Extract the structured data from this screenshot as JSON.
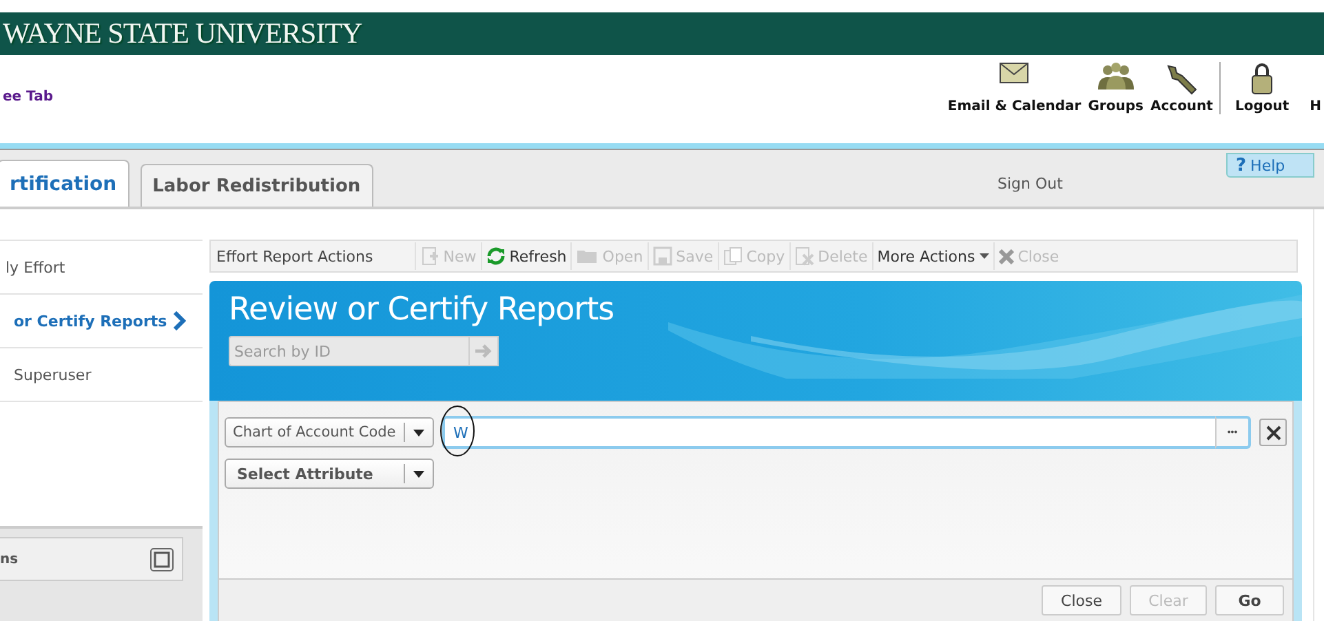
{
  "banner": {
    "title": "WAYNE STATE UNIVERSITY"
  },
  "header": {
    "tab_link": "ee Tab",
    "nav": [
      {
        "label": "Email & Calendar"
      },
      {
        "label": "Groups"
      },
      {
        "label": "Account"
      },
      {
        "label": "Logout"
      },
      {
        "label": "H"
      }
    ]
  },
  "tabs": [
    {
      "label": "rtification",
      "selected": true
    },
    {
      "label": "Labor Redistribution",
      "selected": false
    }
  ],
  "sign_out": "Sign Out",
  "help": "Help",
  "help_icon": "?",
  "sidebar": {
    "items": [
      {
        "label": "ly Effort",
        "selected": false
      },
      {
        "label": "or Certify Reports",
        "selected": true
      },
      {
        "label": "Superuser",
        "selected": false
      }
    ],
    "panel_title": "ns"
  },
  "toolbar": {
    "title": "Effort Report Actions",
    "actions": [
      {
        "label": "New",
        "disabled": true
      },
      {
        "label": "Refresh",
        "disabled": false
      },
      {
        "label": "Open",
        "disabled": true
      },
      {
        "label": "Save",
        "disabled": true
      },
      {
        "label": "Copy",
        "disabled": true
      },
      {
        "label": "Delete",
        "disabled": true
      },
      {
        "label": "More Actions",
        "kind": "menu",
        "disabled": false
      },
      {
        "label": "Close",
        "disabled": true
      }
    ]
  },
  "page": {
    "title": "Review or Certify Reports",
    "search": {
      "placeholder": "Search by ID"
    }
  },
  "filters": [
    {
      "attribute": "Chart of Account Code",
      "value": "W",
      "annotated": true
    }
  ],
  "add_filter": "Select Attribute",
  "ellipsis": "•••",
  "buttons": [
    {
      "label": "Close",
      "disabled": false
    },
    {
      "label": "Clear",
      "disabled": true
    },
    {
      "label": "Go",
      "disabled": false
    }
  ]
}
